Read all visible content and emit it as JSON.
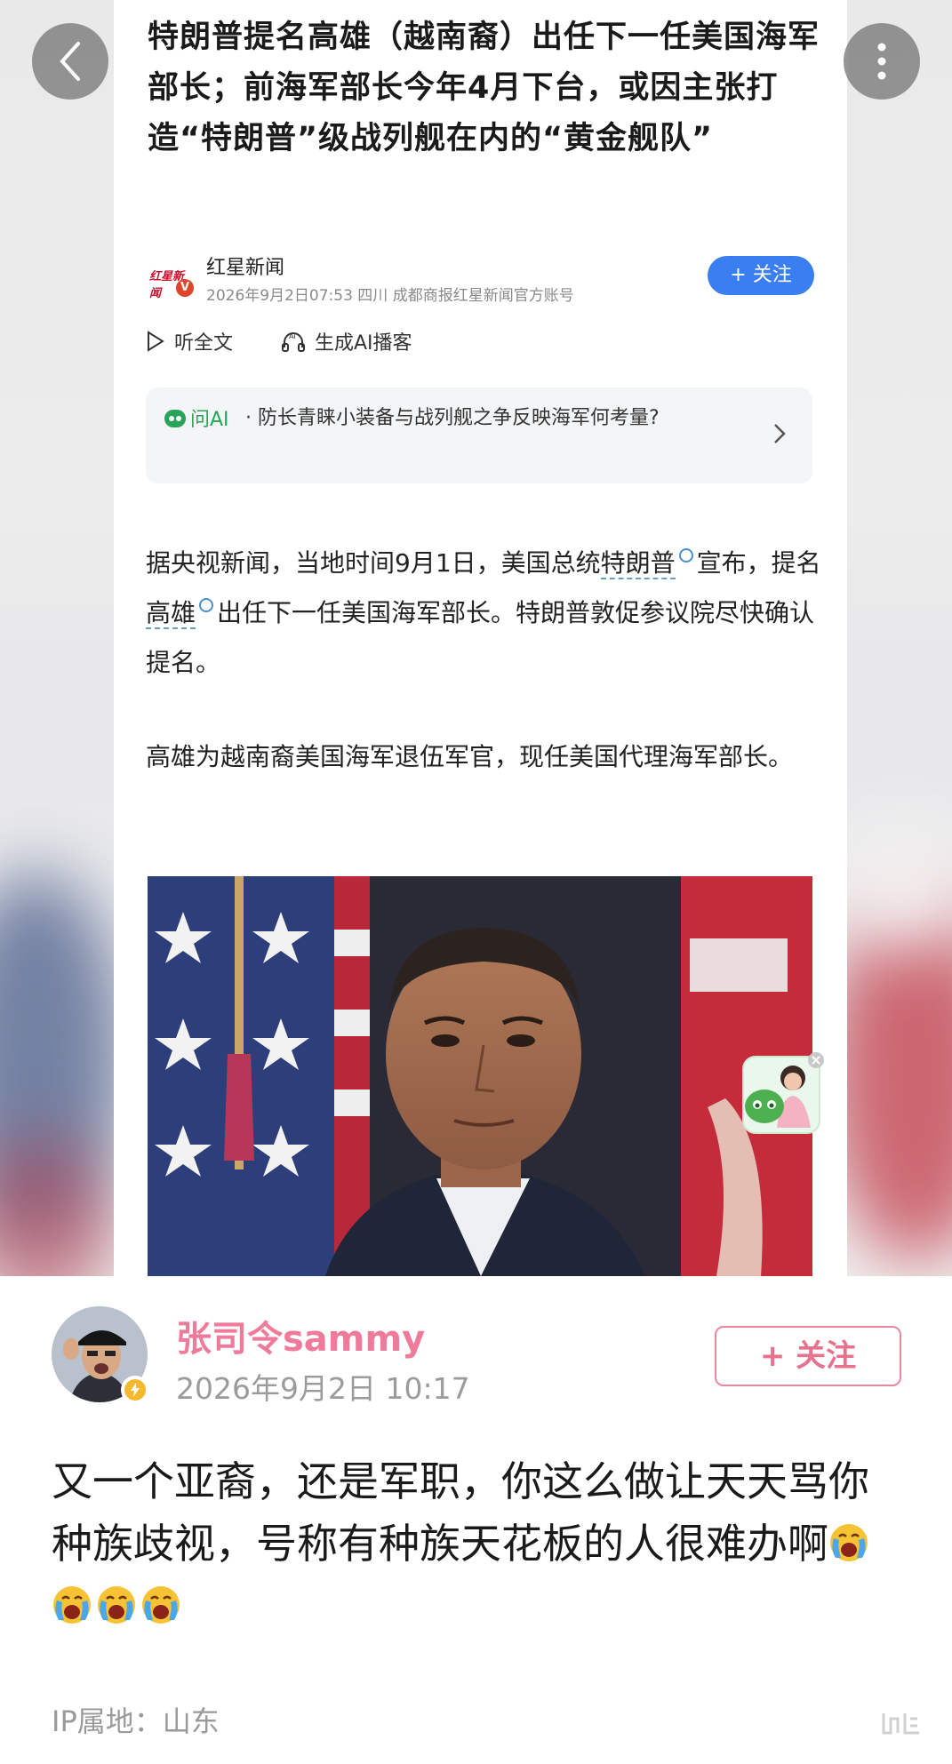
{
  "article": {
    "headline": "特朗普提名高雄（越南裔）出任下一任美国海军部长；前海军部长今年4月下台，或因主张打造“特朗普”级战列舰在内的“黄金舰队”",
    "source_logo_text": "红星新闻",
    "source_name": "红星新闻",
    "source_meta": "2026年9月2日07:53 四川 成都商报红星新闻官方账号",
    "follow_label": "+ 关注",
    "listen_label": "听全文",
    "podcast_label": "生成AI播客",
    "ask_ai_label": "问AI",
    "ask_ai_question": "· 防长青睐小装备与战列舰之争反映海军何考量?",
    "p1_a": "据央视新闻，当地时间9月1日，美国总统",
    "p1_kw1": "特朗普",
    "p1_b": "宣布，提名",
    "p1_kw2": "高雄",
    "p1_c": "出任下一任美国海军部长。特朗普敦促参议院尽快确认提名。",
    "p2": "高雄为越南裔美国海军退伍军官，现任美国代理海军部长。"
  },
  "comment": {
    "username": "张司令sammy",
    "timestamp": "2026年9月2日 10:17",
    "follow_label": "+ 关注",
    "text": "又一个亚裔，还是军职，你这么做让天天骂你种族歧视，号称有种族天花板的人很难办啊",
    "emoji_count": 4,
    "ip_location": "IP属地：山东"
  },
  "colors": {
    "follow_blue": "#3a7ff2",
    "username_pink": "#f07a9a",
    "ask_ai_green": "#27a35a"
  },
  "icons": [
    "back-chevron-icon",
    "more-dots-icon",
    "play-icon",
    "headphones-ai-icon",
    "ask-ai-icon",
    "chevron-right-icon",
    "verified-badge-icon",
    "crying-emoji-icon"
  ]
}
